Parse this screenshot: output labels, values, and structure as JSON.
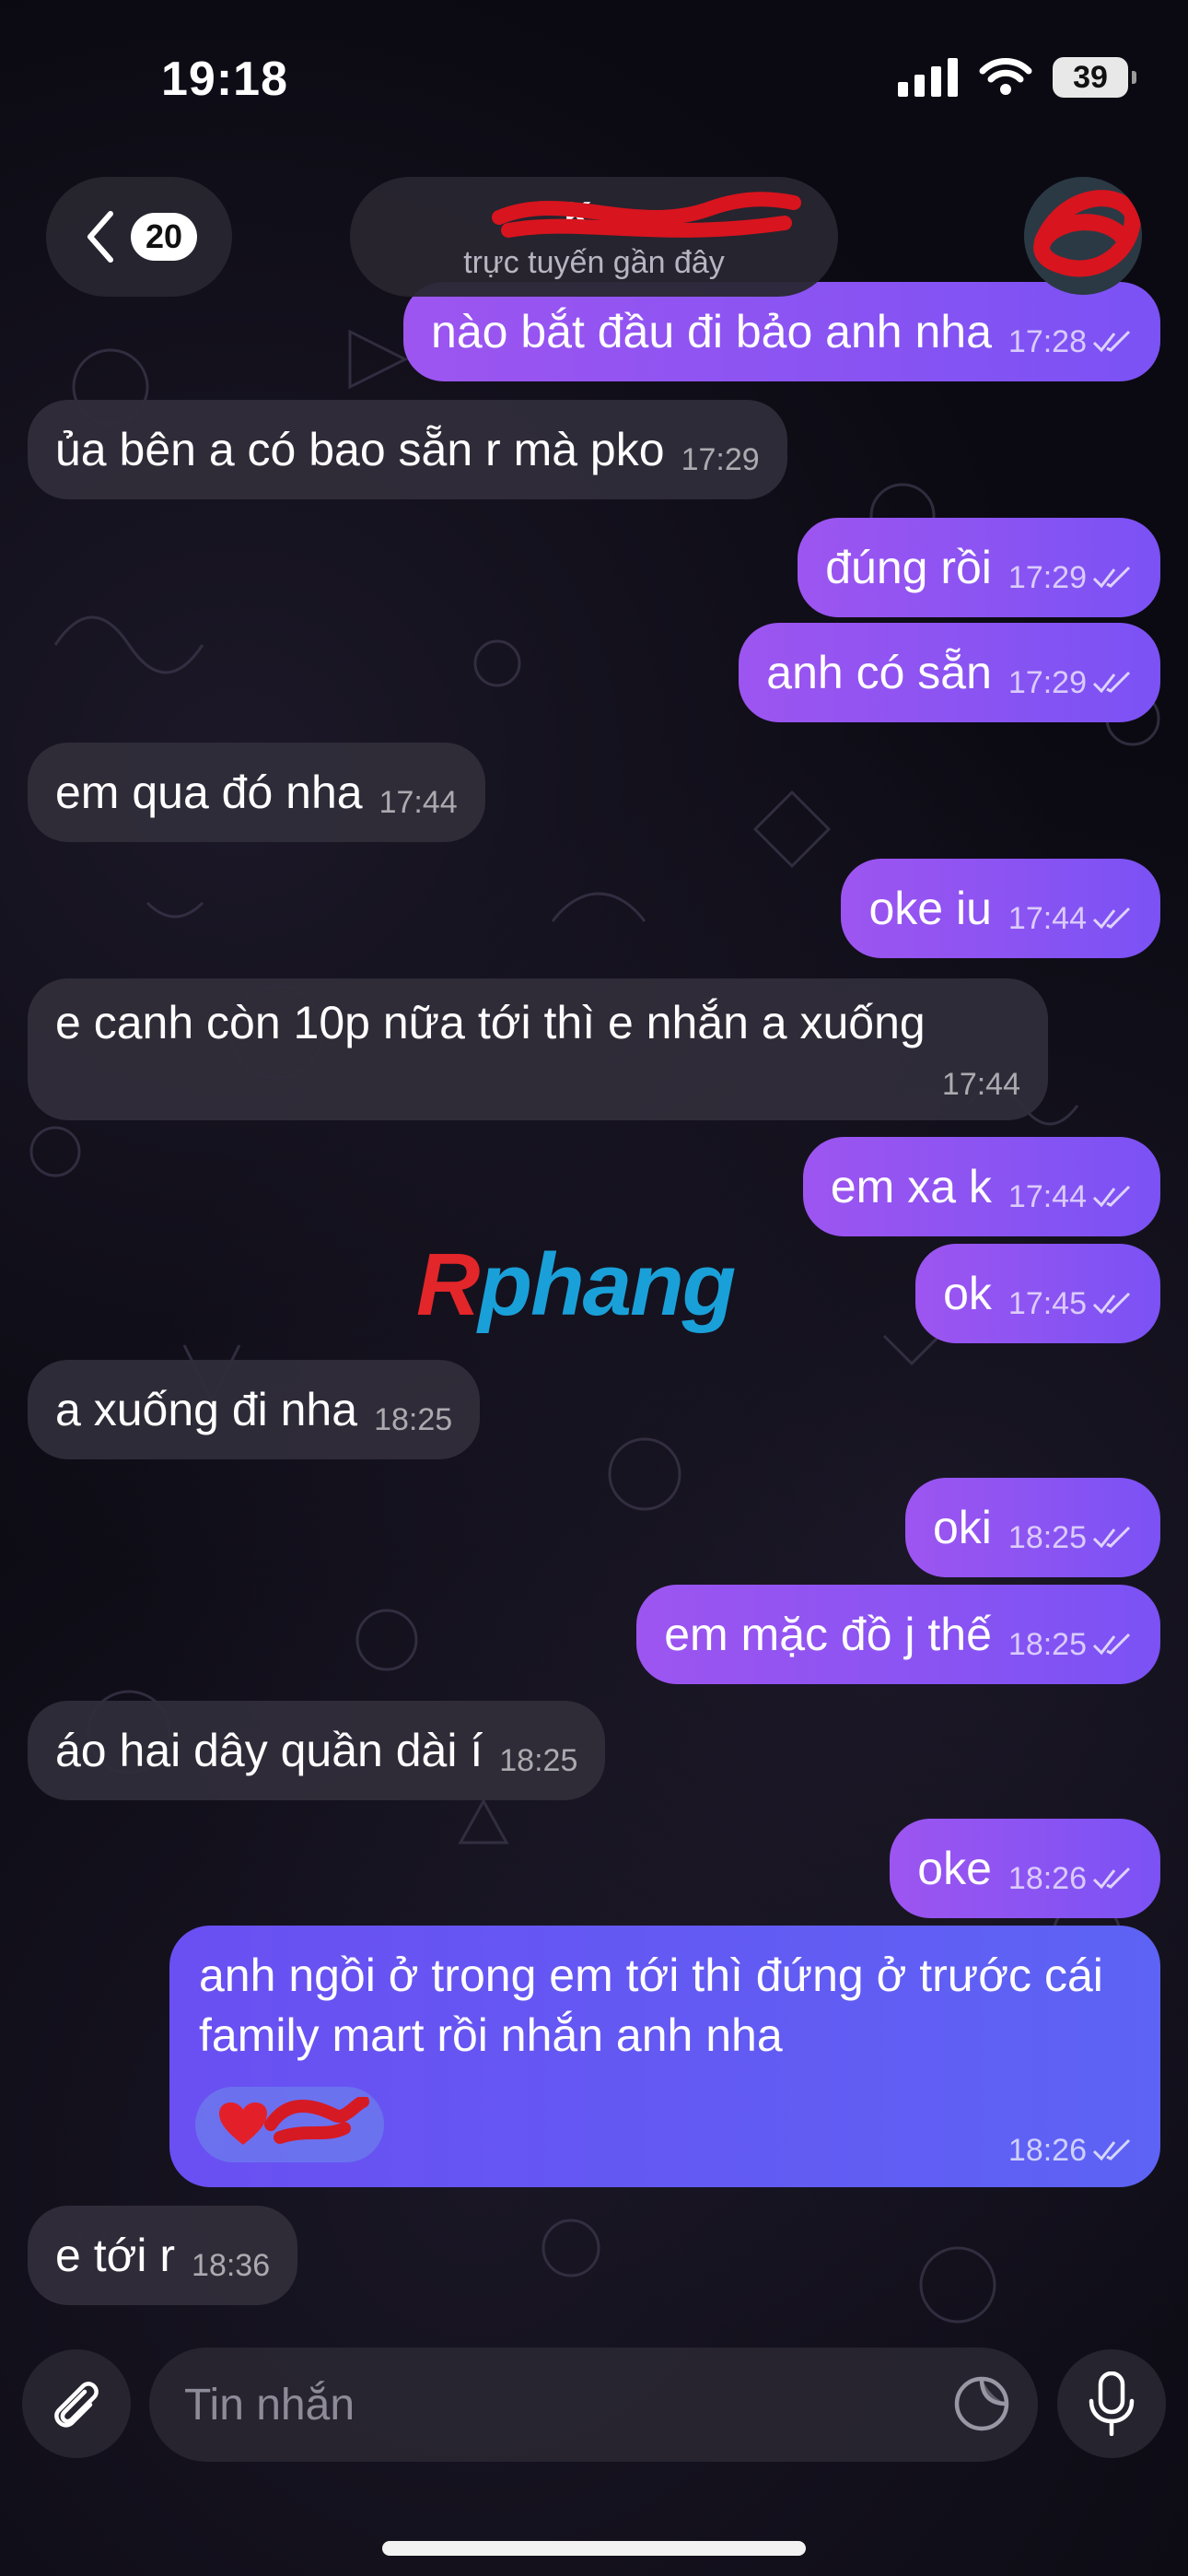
{
  "status_bar": {
    "time": "19:18",
    "battery": "39"
  },
  "header": {
    "back_count": "20",
    "chat_name": "K...",
    "subtitle": "trực tuyến gần đây"
  },
  "watermark": {
    "r": "R",
    "rest": "phang"
  },
  "messages": [
    {
      "dir": "out",
      "text": "nào bắt đầu đi bảo anh nha",
      "time": "17:28"
    },
    {
      "dir": "in",
      "text": "ủa bên a có bao sẵn r mà pko",
      "time": "17:29"
    },
    {
      "dir": "out",
      "text": "đúng rồi",
      "time": "17:29"
    },
    {
      "dir": "out",
      "text": "anh có sẵn",
      "time": "17:29"
    },
    {
      "dir": "in",
      "text": "em qua đó nha",
      "time": "17:44"
    },
    {
      "dir": "out",
      "text": "oke iu",
      "time": "17:44"
    },
    {
      "dir": "in",
      "text": "e canh còn 10p nữa tới thì e nhắn a xuống",
      "time": "17:44"
    },
    {
      "dir": "out",
      "text": "em xa k",
      "time": "17:44"
    },
    {
      "dir": "out",
      "text": "ok",
      "time": "17:45"
    },
    {
      "dir": "in",
      "text": "a xuống đi nha",
      "time": "18:25"
    },
    {
      "dir": "out",
      "text": "oki",
      "time": "18:25"
    },
    {
      "dir": "out",
      "text": "em mặc đồ j thế",
      "time": "18:25"
    },
    {
      "dir": "in",
      "text": "áo hai dây quần dài í",
      "time": "18:25"
    },
    {
      "dir": "out",
      "text": "oke",
      "time": "18:26"
    },
    {
      "dir": "out",
      "text": "anh ngồi ở trong em tới thì đứng ở trước cái family mart rồi nhắn anh nha",
      "time": "18:26",
      "reaction": "heart-icon"
    },
    {
      "dir": "in",
      "text": "e tới r",
      "time": "18:36"
    }
  ],
  "composer": {
    "placeholder": "Tin nhắn"
  },
  "colors": {
    "outgoing": "#8a55f2",
    "outgoing_highlight": "#6156f3",
    "incoming": "#302d3a",
    "background": "#0b0a12"
  }
}
